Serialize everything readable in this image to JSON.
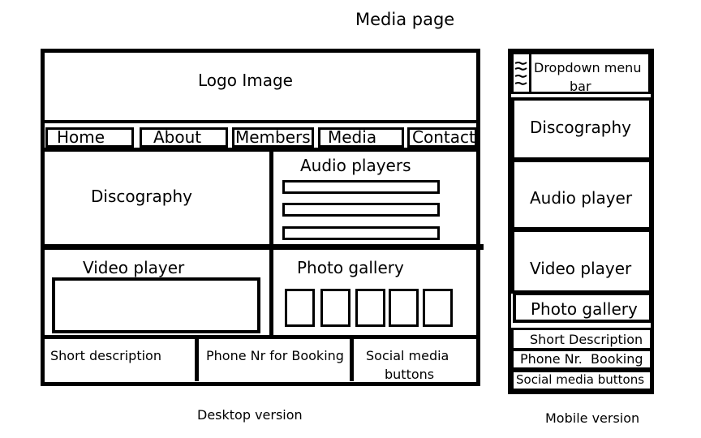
{
  "page_title": "Media page",
  "desktop": {
    "caption": "Desktop version",
    "logo": "Logo Image",
    "nav": [
      "Home",
      "About",
      "Members",
      "Media",
      "Contact"
    ],
    "discography": "Discography",
    "audio_players": "Audio players",
    "video_player": "Video player",
    "photo_gallery": "Photo gallery",
    "footer": {
      "short_description": "Short description",
      "phone": "Phone Nr for Booking",
      "social_line1": "Social media",
      "social_line2": "buttons"
    }
  },
  "mobile": {
    "caption": "Mobile version",
    "dropdown_line1": "Dropdown menu",
    "dropdown_line2": "bar",
    "discography": "Discography",
    "audio_player": "Audio player",
    "video_player": "Video player",
    "photo_gallery": "Photo gallery",
    "short_description": "Short Description",
    "phone": "Phone Nr.  Booking",
    "social": "Social media buttons"
  }
}
